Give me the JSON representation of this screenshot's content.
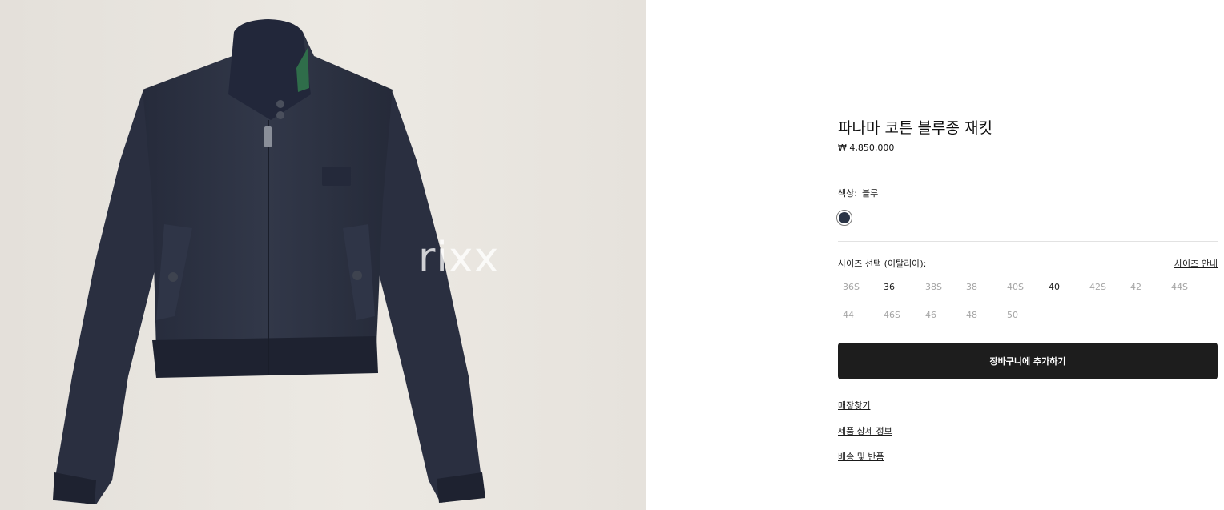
{
  "product": {
    "title": "파나마 코튼 블루종 재킷",
    "price": "₩ 4,850,000",
    "image_watermark": "rixx"
  },
  "color": {
    "label": "색상:",
    "value": "블루",
    "swatch_color": "#2a3446"
  },
  "size": {
    "label": "사이즈 선택 (이탈리아):",
    "guide_label": "사이즈 안내",
    "options": [
      {
        "label": "36S",
        "available": false
      },
      {
        "label": "36",
        "available": true
      },
      {
        "label": "38S",
        "available": false
      },
      {
        "label": "38",
        "available": false
      },
      {
        "label": "40S",
        "available": false
      },
      {
        "label": "40",
        "available": true
      },
      {
        "label": "42S",
        "available": false
      },
      {
        "label": "42",
        "available": false
      },
      {
        "label": "44S",
        "available": false
      },
      {
        "label": "44",
        "available": false
      },
      {
        "label": "46S",
        "available": false
      },
      {
        "label": "46",
        "available": false
      },
      {
        "label": "48",
        "available": false
      },
      {
        "label": "50",
        "available": false
      }
    ]
  },
  "actions": {
    "add_to_cart": "장바구니에 추가하기",
    "links": [
      "매장찾기",
      "제품 상세 정보",
      "배송 및 반품"
    ]
  },
  "colors": {
    "button_bg": "#1d1d1d",
    "jacket": "#2b3143"
  }
}
